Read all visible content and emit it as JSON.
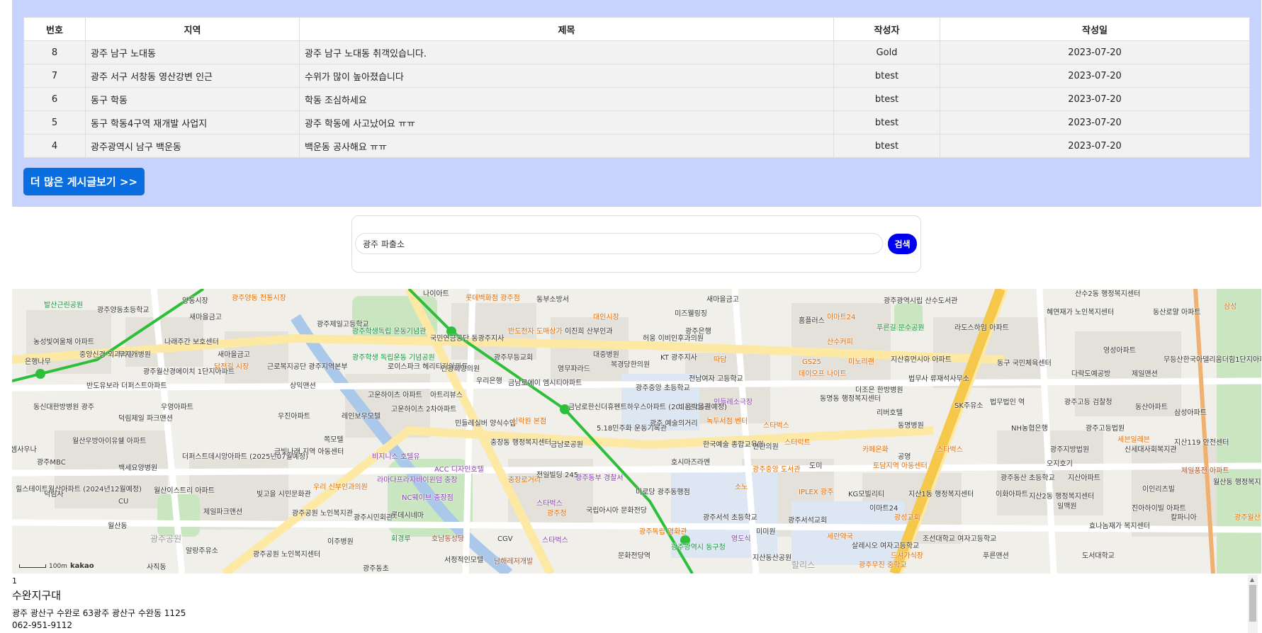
{
  "board": {
    "headers": [
      "번호",
      "지역",
      "제목",
      "작성자",
      "작성일"
    ],
    "rows": [
      {
        "no": "8",
        "region": "광주 남구 노대동",
        "title": "광주 남구 노대동 취객있습니다.",
        "author": "Gold",
        "date": "2023-07-20"
      },
      {
        "no": "7",
        "region": "광주 서구 서창동 영산강변 인근",
        "title": "수위가 많이 높아졌습니다",
        "author": "btest",
        "date": "2023-07-20"
      },
      {
        "no": "6",
        "region": "동구 학동",
        "title": "학동 조심하세요",
        "author": "btest",
        "date": "2023-07-20"
      },
      {
        "no": "5",
        "region": "동구 학동4구역 재개발 사업지",
        "title": "광주 학동에 사고났어요 ㅠㅠ",
        "author": "btest",
        "date": "2023-07-20"
      },
      {
        "no": "4",
        "region": "광주광역시 남구 백운동",
        "title": "백운동 공사해요 ㅠㅠ",
        "author": "btest",
        "date": "2023-07-20"
      }
    ],
    "more_label": "더 많은 게시글보기 >>",
    "colors": {
      "panel": "#c8d3fd",
      "button": "#0a6de0"
    }
  },
  "search": {
    "value": "광주 파출소",
    "button_label": "검색",
    "button_color": "#0000f0"
  },
  "map": {
    "labels": [
      "발산근린공원",
      "광주양동초등학교",
      "양동시장",
      "광주양동 전통시장",
      "나이아트",
      "롯데백화점 광주점",
      "동부소방서",
      "새마을금고",
      "광주광역시립 산수도서관",
      "산수2동 행정복지센터",
      "혜연재가 노인복지센터",
      "동산로얄 아파트",
      "새마을금고",
      "광주제일고등학교",
      "광주학생독립 운동기념관",
      "국민연금공단 동광주지사",
      "반도전자 도매상가",
      "이진희 산부인과",
      "대인시장",
      "미즈웰링징",
      "광주은행",
      "홈플러스",
      "이마트24",
      "푸른길 문수공원",
      "라도스하임 아파트",
      "삼성",
      "농성빛여울채 아파트",
      "중앙신경 외과의원",
      "무지개병원",
      "나래주간 보호센터",
      "새마을금고",
      "광주무등교회",
      "대중병원",
      "허웅 이비인후과의원",
      "KT 광주지사",
      "따담",
      "GS25",
      "산수커피",
      "지산휴먼시아 아파트",
      "동구 국민체육센터",
      "영성아파트",
      "무등산한국아델리움더힘1단지아파트 (2024년02월예정)",
      "은행나무",
      "광주월산경에이치 1단지아파트",
      "닭전길 시장",
      "근로복지공단 광주지역본부",
      "광주학생 독립운동 기념공원",
      "로이스파크 헤리티지아파트",
      "인광희양의원",
      "영무파라드",
      "복경당한의원",
      "전남여자 고등학교",
      "미노리랜",
      "데이오프 나이트",
      "법무사 류재석사무소",
      "다락도예공방",
      "제일맨션",
      "반도유보라 더퍼스트아파트",
      "우영아파트",
      "상익맨션",
      "고운하이츠 아파트",
      "아트리뷰스",
      "금남로에이 엠시티아파트",
      "우리은행",
      "광주중앙 초등학교",
      "인들레소극장",
      "동명동 행정복지센터",
      "더조은 한방병원",
      "SK주유소",
      "법무법인 역",
      "광주고등 검찰청",
      "삼성아파트",
      "동산아파트",
      "동신대한방병원 광주",
      "덕림제일 파크맨션",
      "우진아파트",
      "레인보우모텔",
      "고운하이츠 2차아파트",
      "금남로한신더휴펜트하우스아파트 (2024년05월예정)",
      "비움박물관",
      "녹두서점 벤터",
      "스타벅스",
      "리버호텔",
      "동명병원",
      "NH농협은행",
      "광주고등법원",
      "민들레실버 양식수업",
      "5.18민주화 운동기록관",
      "신락원 본점",
      "광주 예술의거리",
      "쪽모텔",
      "스터럭트",
      "세븐일레븐",
      "지산119 안전센터",
      "월산우방아이유쉘 아파트",
      "더퍼스트데시앙아파트 (2025년07월예정)",
      "금빛나래 지역 아동센터",
      "충장동 행정복지센터",
      "금남로공원",
      "한국예술 종합교육원",
      "면한의원",
      "카페온화",
      "공영",
      "광주지방법원",
      "스타벅스",
      "신세대사회복지관",
      "셈사우나",
      "광주MBC",
      "백세요양병원",
      "비지니스 호텔유",
      "ACC 디자인호텔",
      "광주동부 경찰서",
      "호시마즈라멘",
      "광주중앙 도서관",
      "도미",
      "토담지역 아동센터",
      "오지호기",
      "제일풍전 아파트",
      "힐스테이트월산아파트 (2024년12월예정)",
      "덕림사",
      "월산이스트리 아파트",
      "CU",
      "우리 신부인과의원",
      "빛고을 시민문화관",
      "라마다프라자바이윈덤 충장",
      "NC웨이브 충장점",
      "충장로거리",
      "전일빌딩 245",
      "미로당 광주동행점",
      "소노",
      "IPLEX 광주",
      "KG모빌리티",
      "지산1동 행정복지센터",
      "광주동산 초등학교",
      "지산아파트",
      "이인리츠빌",
      "월산동 행정복지센터",
      "제일파크맨션",
      "광주공원 노인복지관",
      "광주시민회관",
      "롯데시네마",
      "스타벅스",
      "광주청",
      "국립아시아 문화전당",
      "광주서석 초등학교",
      "광주서석교회",
      "이마트24",
      "광성교회",
      "이화아파트",
      "지산2동 행정복지센터",
      "일맥원",
      "진아하이빌 아파트",
      "칼파니아",
      "광주월산 초등학교",
      "월산동",
      "광주공원",
      "회경루",
      "호남동성당",
      "CGV",
      "스타벅스",
      "광주독립 영화관",
      "영도식",
      "미미원",
      "세란약국",
      "살레시오 여자고등학교",
      "조선대학교 여자고등학교",
      "푸른맨션",
      "효나놈재가 복지센터",
      "알랑주유소",
      "광주공원 노인복지센터",
      "이주병원",
      "서정적인모텔",
      "남해레저개발",
      "문화전당역",
      "광주광역시 동구청",
      "지산동산공원",
      "할리스",
      "드셔가식장",
      "광주무진 중학교",
      "사직동",
      "광주동초",
      "도서대학교"
    ]
  },
  "info": {
    "index": "1",
    "name": "수완지구대",
    "address": "광주 광산구 수완로 63광주 광산구 수완동 1125",
    "phone": "062-951-9112"
  }
}
